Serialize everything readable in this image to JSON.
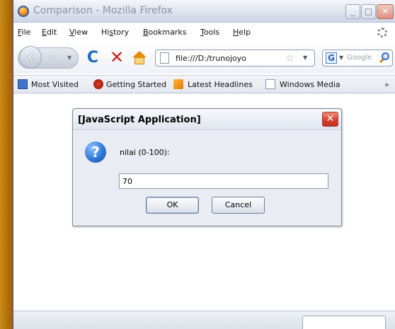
{
  "window": {
    "title": "Comparison - Mozilla Firefox",
    "controls": {
      "minimize": "_",
      "maximize": "□",
      "close": "✕"
    }
  },
  "menu": {
    "items": [
      {
        "key": "F",
        "rest": "ile"
      },
      {
        "key": "E",
        "rest": "dit"
      },
      {
        "key": "V",
        "rest": "iew"
      },
      {
        "pre": "Hi",
        "key": "s",
        "rest": "tory"
      },
      {
        "key": "B",
        "rest": "ookmarks"
      },
      {
        "key": "T",
        "rest": "ools"
      },
      {
        "key": "H",
        "rest": "elp"
      }
    ]
  },
  "navbar": {
    "back": "‹",
    "forward": "›",
    "reload": "C",
    "stop": "✕",
    "url": "file:///D:/trunojoyo",
    "star": "☆",
    "search_engine": "G",
    "search_placeholder": "Google",
    "dropdown": "▼"
  },
  "bookmarks": {
    "items": [
      "Most Visited",
      "Getting Started",
      "Latest Headlines",
      "Windows Media"
    ],
    "more": "»"
  },
  "dialog": {
    "title": "[JavaScript Application]",
    "close": "✕",
    "icon": "?",
    "prompt": "nilai (0-100):",
    "input_value": "70",
    "ok_label": "OK",
    "cancel_label": "Cancel"
  },
  "colors": {
    "accent": "#2f79d8",
    "close_red": "#d4412f",
    "stop_red": "#d11e1e",
    "reload_blue": "#1f6bc4",
    "background_orange": "#a05c05"
  }
}
